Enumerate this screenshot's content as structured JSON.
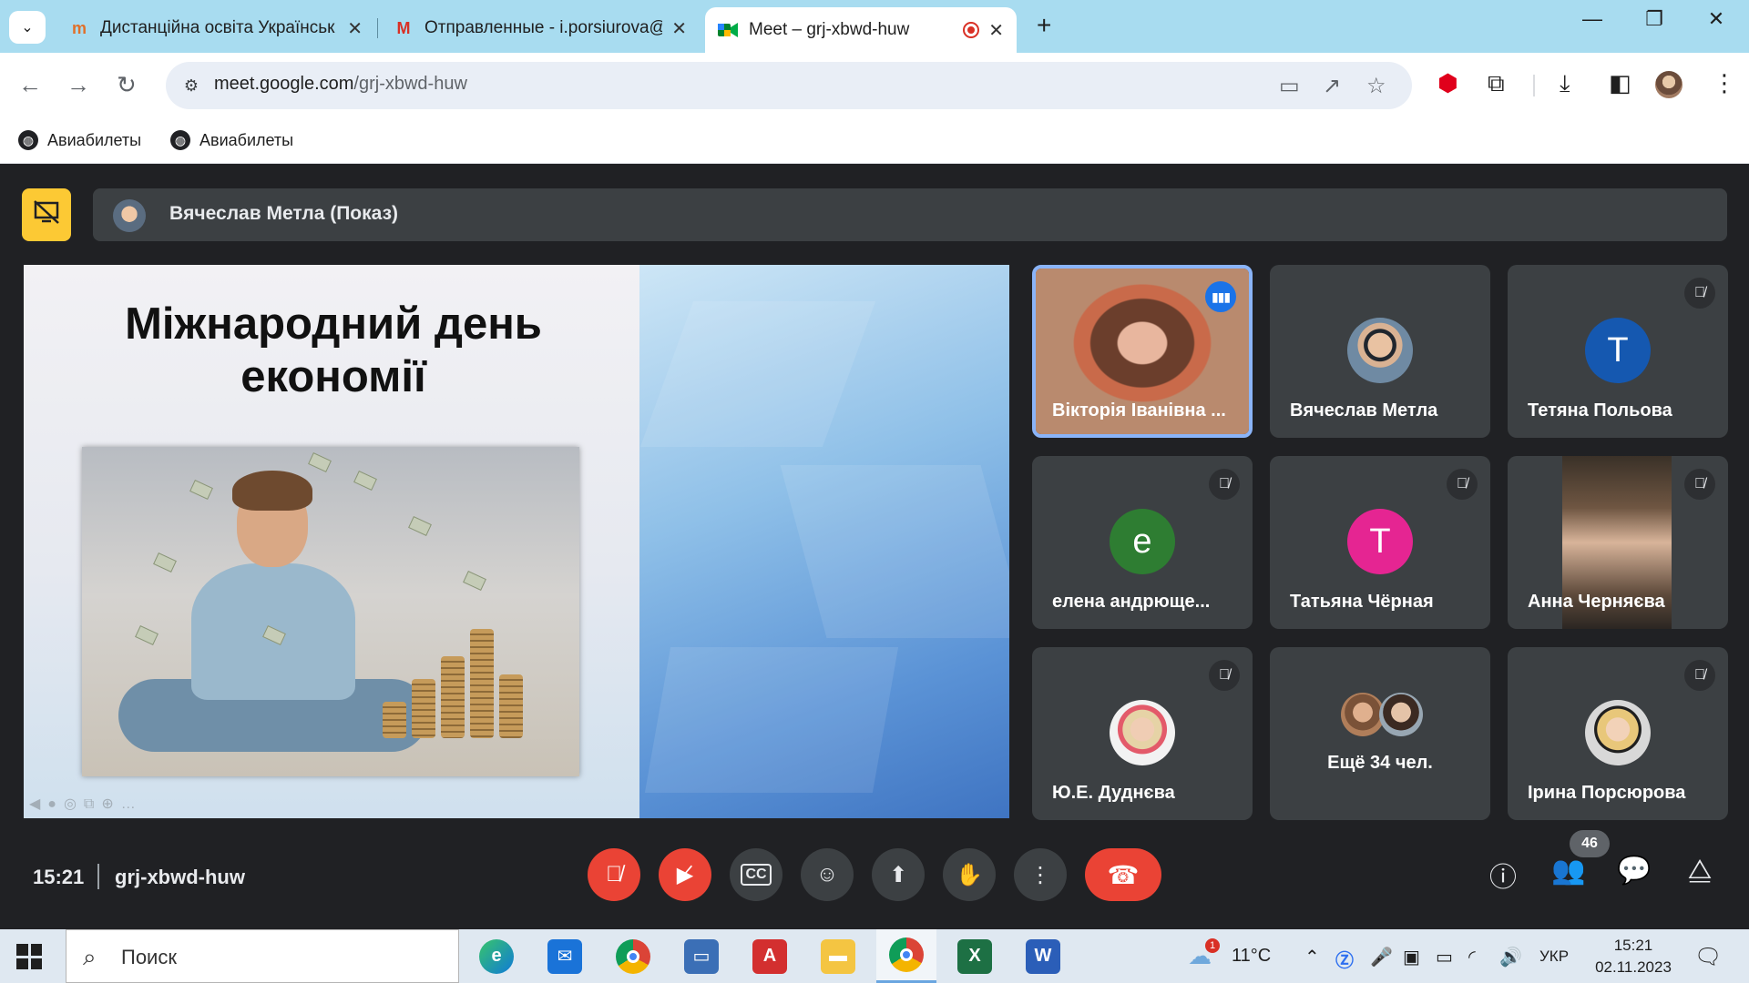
{
  "browser": {
    "tabs": [
      {
        "title": "Дистанційна освіта Українськ",
        "favicon": "moodle-icon"
      },
      {
        "title": "Отправленные - i.porsiurova@",
        "favicon": "gmail-icon"
      },
      {
        "title": "Meet – grj-xbwd-huw",
        "favicon": "meet-icon",
        "active": true
      }
    ],
    "url_host": "meet.google.com",
    "url_path": "/grj-xbwd-huw",
    "bookmarks": [
      "Авиабилеты",
      "Авиабилеты"
    ]
  },
  "meet": {
    "presenter_label": "Вячеслав Метла (Показ)",
    "slide": {
      "title_line1": "Міжнародний день",
      "title_line2": "економії"
    },
    "participants": [
      {
        "name": "Вікторія Іванівна ...",
        "speaking": true,
        "muted": false
      },
      {
        "name": "Вячеслав Метла",
        "muted": false
      },
      {
        "name": "Тетяна Польова",
        "initial": "T",
        "color": "#1558b0",
        "muted": true
      },
      {
        "name": "елена андрюще...",
        "initial": "е",
        "color": "#2e7d32",
        "muted": true
      },
      {
        "name": "Татьяна Чёрная",
        "initial": "T",
        "color": "#e52592",
        "muted": true
      },
      {
        "name": "Анна Черняєва",
        "muted": true
      },
      {
        "name": "Ю.Е. Дуднєва",
        "muted": true
      },
      {
        "name": "Ірина Порсюрова",
        "muted": true
      }
    ],
    "more_label": "Ещё 34 чел.",
    "time": "15:21",
    "meeting_code": "grj-xbwd-huw",
    "participant_count": "46"
  },
  "taskbar": {
    "search_placeholder": "Поиск",
    "weather": "11°C",
    "language": "УКР",
    "time": "15:21",
    "date": "02.11.2023",
    "weather_badge": "1"
  },
  "colors": {
    "meet_bg": "#202124",
    "tile_bg": "#3c4043",
    "end_call": "#ea4335",
    "accent": "#8ab4f8",
    "present": "#fcc934"
  }
}
